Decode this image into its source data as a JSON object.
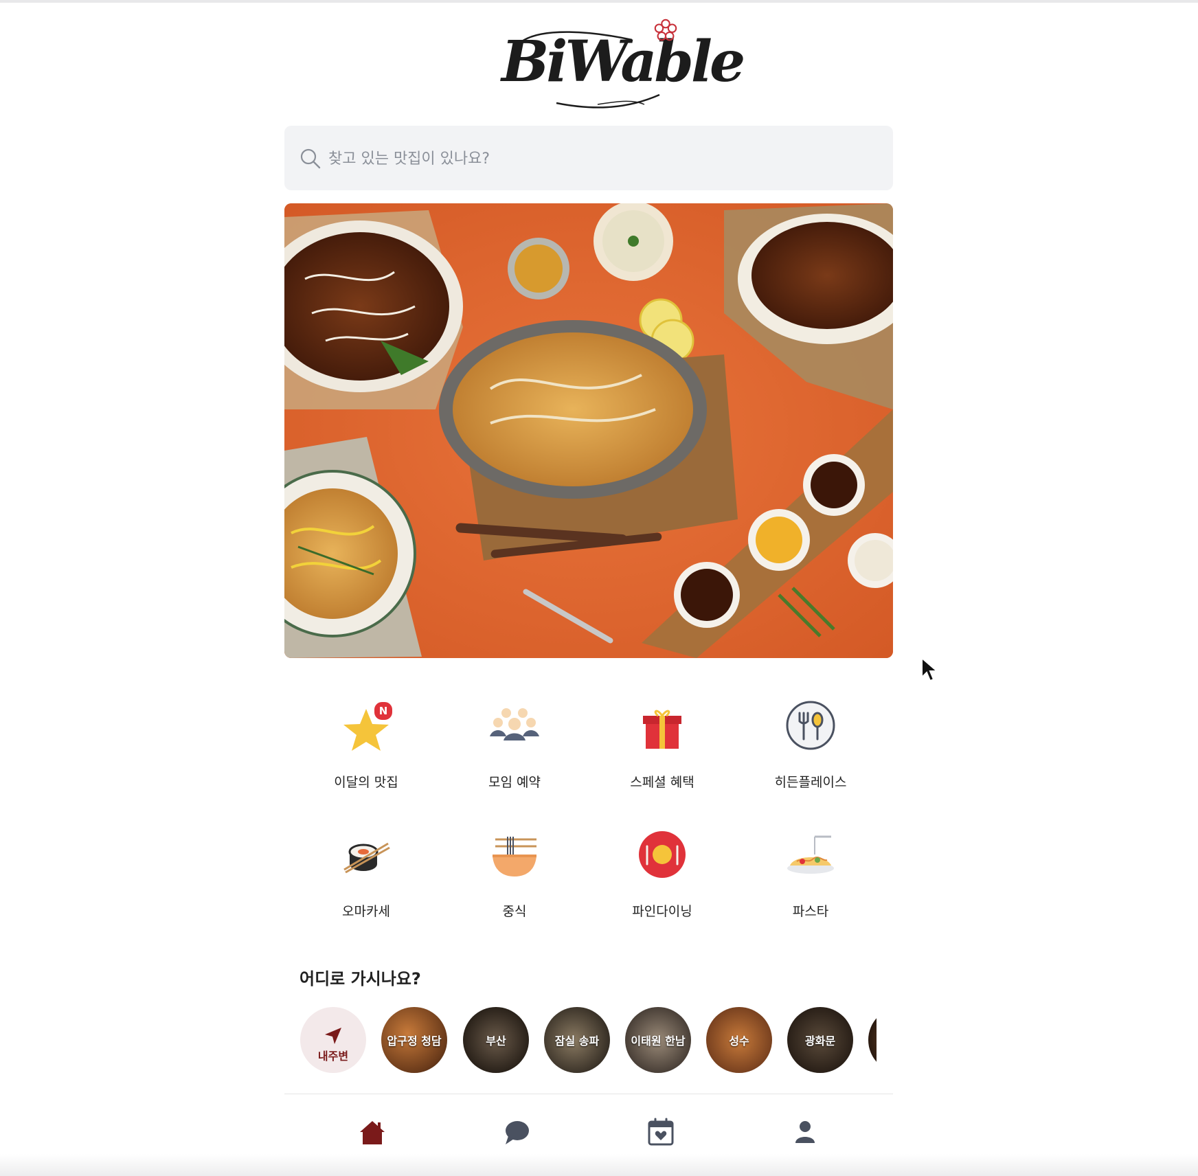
{
  "brand": {
    "logo_text": "BiWable",
    "accent_color": "#c8313a",
    "dark_brand_color": "#7a1a1a"
  },
  "search": {
    "placeholder": "찾고 있는 맛집이 있나요?",
    "icon": "search-icon"
  },
  "hero": {
    "image": "hero-food-photo"
  },
  "categories": [
    {
      "label": "이달의 맛집",
      "icon": "star-icon",
      "badge": "N"
    },
    {
      "label": "모임 예약",
      "icon": "group-icon"
    },
    {
      "label": "스페셜 혜택",
      "icon": "gift-icon"
    },
    {
      "label": "히든플레이스",
      "icon": "utensils-icon"
    },
    {
      "label": "오마카세",
      "icon": "sushi-icon"
    },
    {
      "label": "중식",
      "icon": "noodle-bowl-icon"
    },
    {
      "label": "파인다이닝",
      "icon": "plate-icon"
    },
    {
      "label": "파스타",
      "icon": "pasta-icon"
    }
  ],
  "locations": {
    "title": "어디로 가시나요?",
    "items": [
      {
        "label": "내주변",
        "icon": "location-arrow-icon"
      },
      {
        "label": "압구정 청담"
      },
      {
        "label": "부산"
      },
      {
        "label": "잠실 송파"
      },
      {
        "label": "이태원 한남"
      },
      {
        "label": "성수"
      },
      {
        "label": "광화문"
      }
    ]
  },
  "bottom_nav": {
    "items": [
      {
        "name": "home",
        "icon": "home-icon",
        "active": true
      },
      {
        "name": "chat",
        "icon": "chat-icon",
        "active": false
      },
      {
        "name": "calendar",
        "icon": "calendar-heart-icon",
        "active": false
      },
      {
        "name": "profile",
        "icon": "user-icon",
        "active": false
      }
    ],
    "active_color": "#7a1a1a",
    "inactive_color": "#4a5160"
  }
}
